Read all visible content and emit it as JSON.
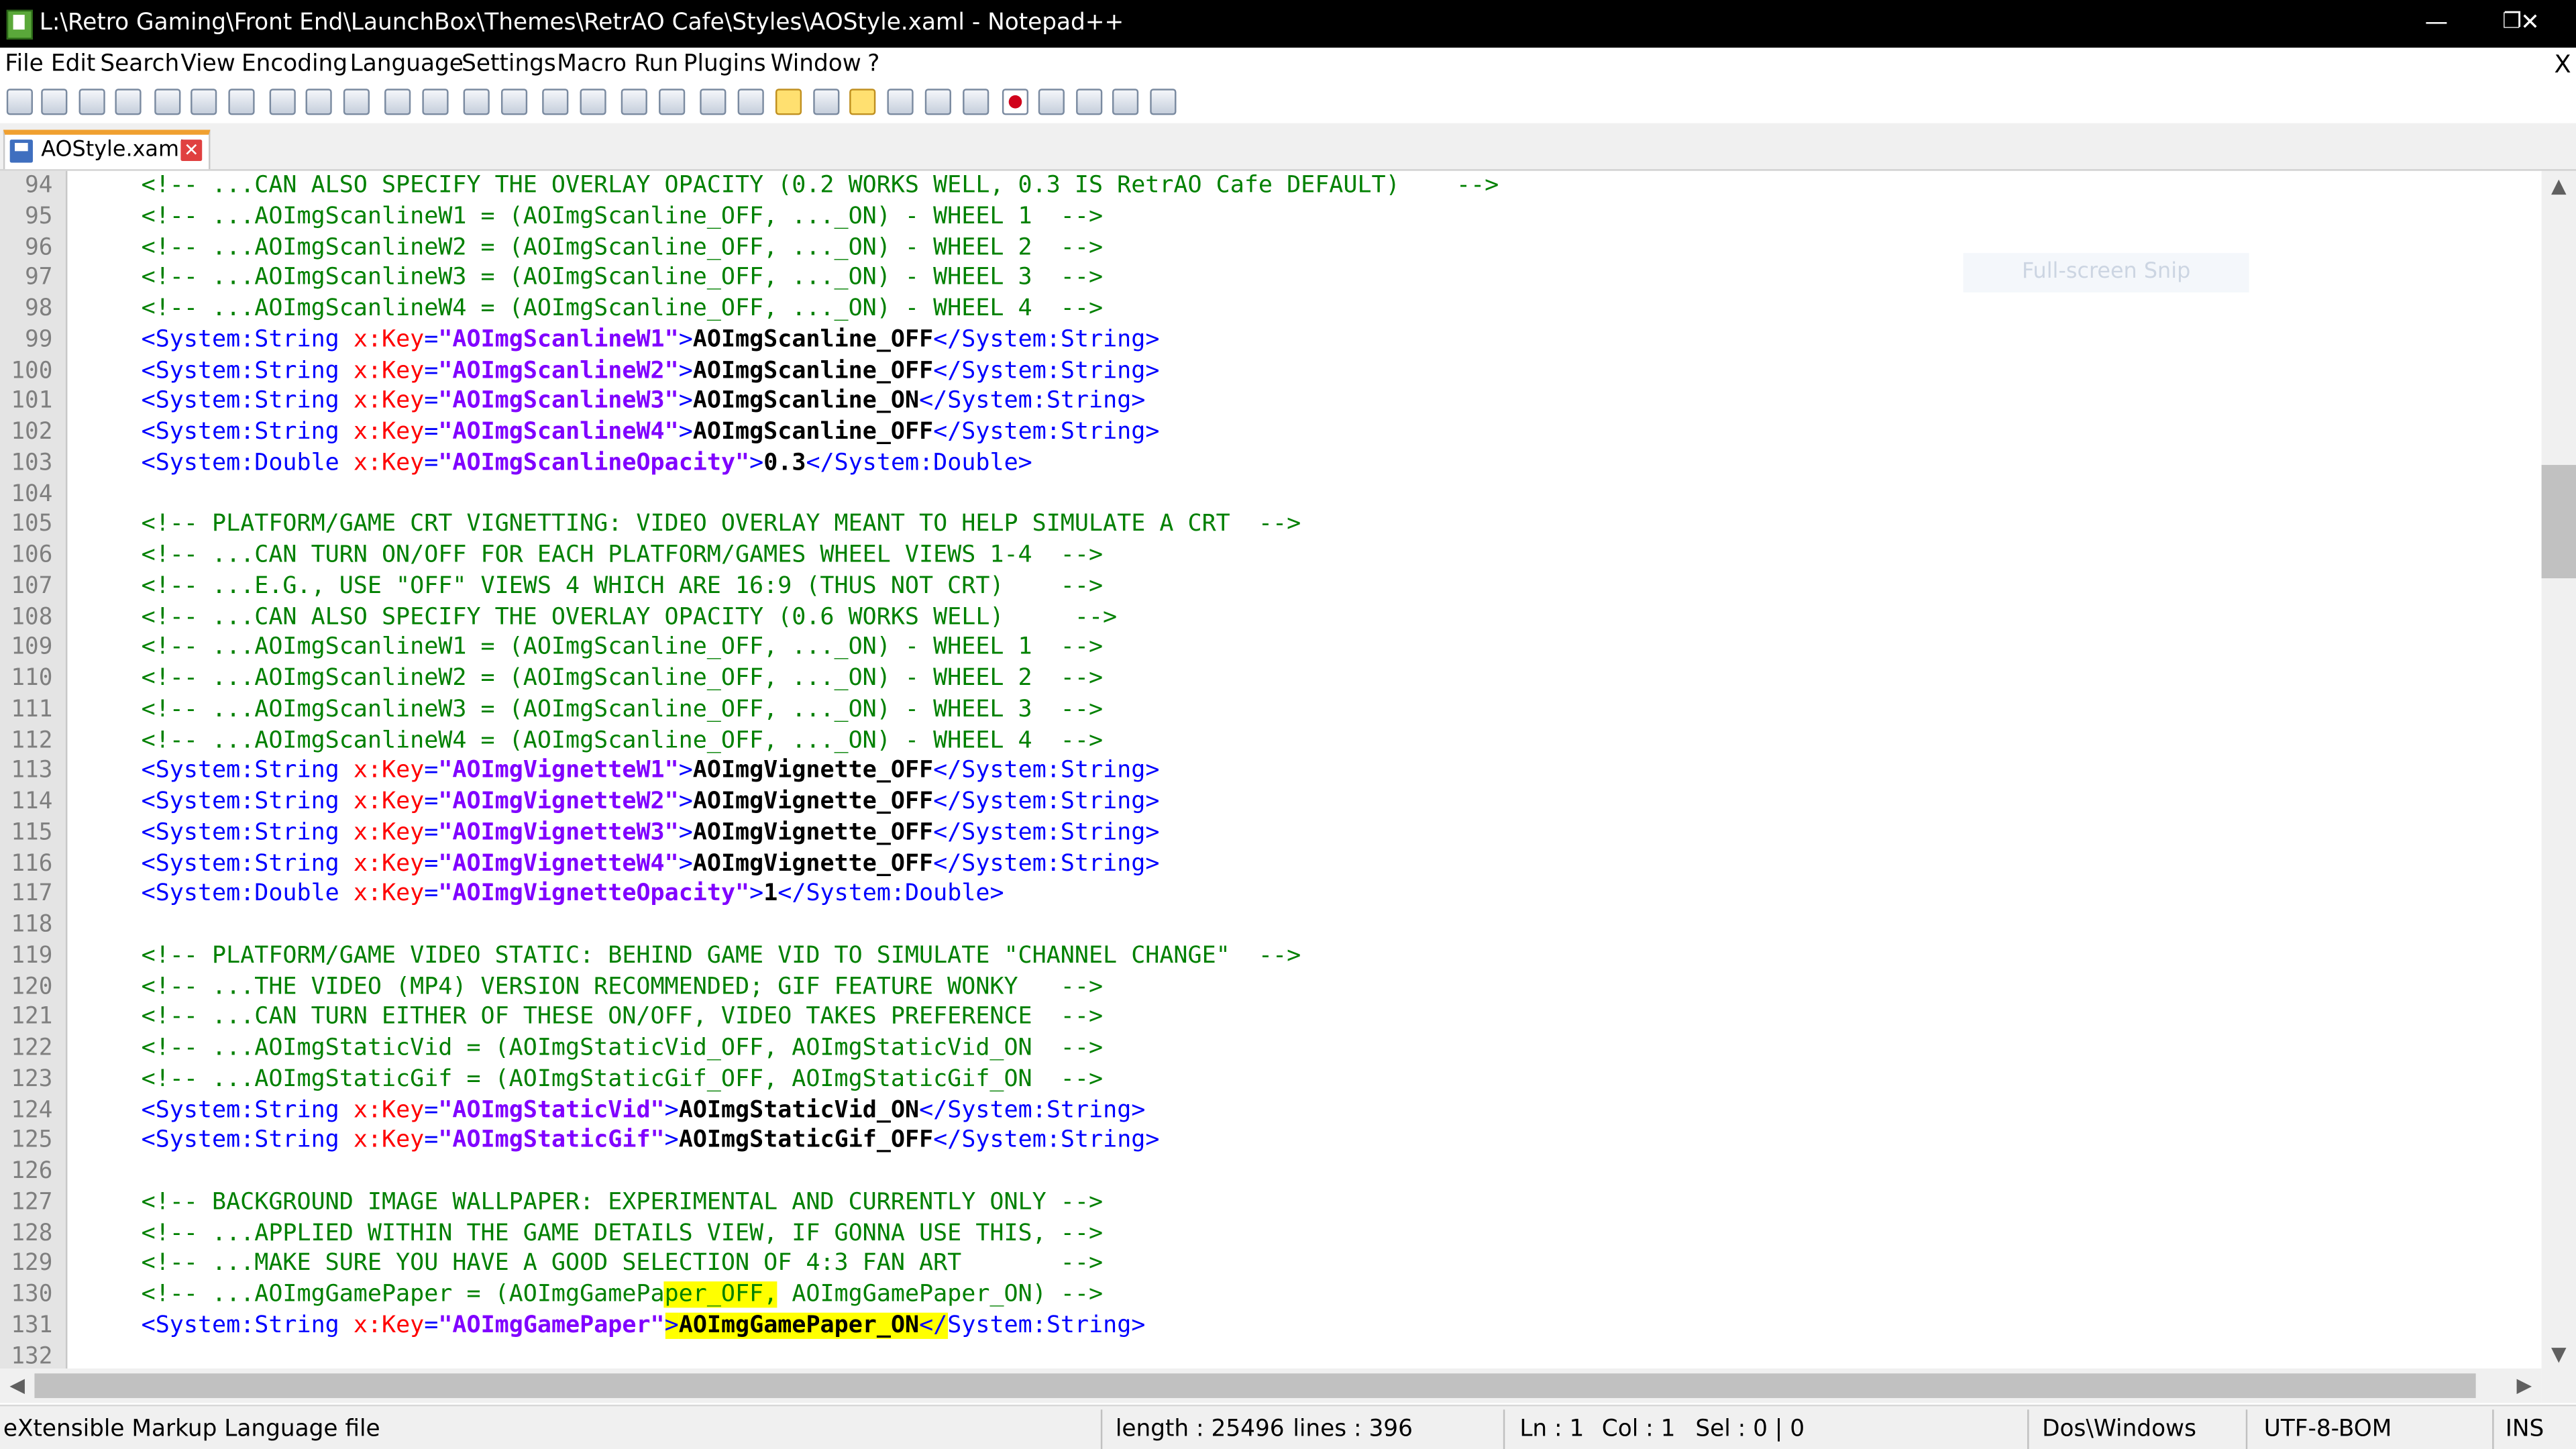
{
  "window": {
    "title": "L:\\Retro Gaming\\Front End\\LaunchBox\\Themes\\RetrAO Cafe\\Styles\\AOStyle.xaml - Notepad++",
    "minimize": "—",
    "maximize": "❐",
    "close": "✕"
  },
  "menu": {
    "items": [
      "File",
      "Edit",
      "Search",
      "View",
      "Encoding",
      "Language",
      "Settings",
      "Macro",
      "Run",
      "Plugins",
      "Window",
      "?"
    ],
    "close": "X"
  },
  "toolbar": {
    "icons": [
      "new-file-icon",
      "open-file-icon",
      "save-icon",
      "save-all-icon",
      "close-icon",
      "close-all-icon",
      "print-icon",
      "cut-icon",
      "copy-icon",
      "paste-icon",
      "undo-icon",
      "redo-icon",
      "find-icon",
      "replace-icon",
      "zoom-in-icon",
      "zoom-out-icon",
      "sync-scroll-vertical-icon",
      "sync-scroll-horizontal-icon",
      "word-wrap-icon",
      "show-all-characters-icon",
      "indent-guide-icon",
      "document-map-icon",
      "function-list-icon",
      "folder-as-workspace-icon",
      "monitoring-icon",
      "start-recording-icon",
      "stop-recording-icon",
      "playback-icon",
      "run-macro-multiple-icon",
      "save-macro-icon"
    ]
  },
  "tab": {
    "label": "AOStyle.xaml",
    "close": "✕"
  },
  "editor": {
    "lines": [
      {
        "n": "94",
        "segments": [
          {
            "t": "<!-- ...CAN ALSO SPECIFY THE OVERLAY OPACITY (0.2 WORKS WELL, 0.3 IS RetrAO Cafe DEFAULT)    -->",
            "c": "comment"
          }
        ]
      },
      {
        "n": "95",
        "segments": [
          {
            "t": "<!-- ...AOImgScanlineW1 = (AOImgScanline_OFF, ..._ON) - WHEEL 1  -->",
            "c": "comment"
          }
        ]
      },
      {
        "n": "96",
        "segments": [
          {
            "t": "<!-- ...AOImgScanlineW2 = (AOImgScanline_OFF, ..._ON) - WHEEL 2  -->",
            "c": "comment"
          }
        ]
      },
      {
        "n": "97",
        "segments": [
          {
            "t": "<!-- ...AOImgScanlineW3 = (AOImgScanline_OFF, ..._ON) - WHEEL 3  -->",
            "c": "comment"
          }
        ]
      },
      {
        "n": "98",
        "segments": [
          {
            "t": "<!-- ...AOImgScanlineW4 = (AOImgScanline_OFF, ..._ON) - WHEEL 4  -->",
            "c": "comment"
          }
        ]
      },
      {
        "n": "99",
        "segments": [
          {
            "t": "<System:String ",
            "c": "tag"
          },
          {
            "t": "x:Key",
            "c": "attr"
          },
          {
            "t": "=",
            "c": "tag"
          },
          {
            "t": "\"AOImgScanlineW1\"",
            "c": "val"
          },
          {
            "t": ">",
            "c": "tag"
          },
          {
            "t": "AOImgScanline_OFF",
            "c": "text"
          },
          {
            "t": "</System:String>",
            "c": "tag"
          }
        ]
      },
      {
        "n": "100",
        "segments": [
          {
            "t": "<System:String ",
            "c": "tag"
          },
          {
            "t": "x:Key",
            "c": "attr"
          },
          {
            "t": "=",
            "c": "tag"
          },
          {
            "t": "\"AOImgScanlineW2\"",
            "c": "val"
          },
          {
            "t": ">",
            "c": "tag"
          },
          {
            "t": "AOImgScanline_OFF",
            "c": "text"
          },
          {
            "t": "</System:String>",
            "c": "tag"
          }
        ]
      },
      {
        "n": "101",
        "segments": [
          {
            "t": "<System:String ",
            "c": "tag"
          },
          {
            "t": "x:Key",
            "c": "attr"
          },
          {
            "t": "=",
            "c": "tag"
          },
          {
            "t": "\"AOImgScanlineW3\"",
            "c": "val"
          },
          {
            "t": ">",
            "c": "tag"
          },
          {
            "t": "AOImgScanline_ON",
            "c": "text"
          },
          {
            "t": "</System:String>",
            "c": "tag"
          }
        ]
      },
      {
        "n": "102",
        "segments": [
          {
            "t": "<System:String ",
            "c": "tag"
          },
          {
            "t": "x:Key",
            "c": "attr"
          },
          {
            "t": "=",
            "c": "tag"
          },
          {
            "t": "\"AOImgScanlineW4\"",
            "c": "val"
          },
          {
            "t": ">",
            "c": "tag"
          },
          {
            "t": "AOImgScanline_OFF",
            "c": "text"
          },
          {
            "t": "</System:String>",
            "c": "tag"
          }
        ]
      },
      {
        "n": "103",
        "segments": [
          {
            "t": "<System:Double ",
            "c": "tag"
          },
          {
            "t": "x:Key",
            "c": "attr"
          },
          {
            "t": "=",
            "c": "tag"
          },
          {
            "t": "\"AOImgScanlineOpacity\"",
            "c": "val"
          },
          {
            "t": ">",
            "c": "tag"
          },
          {
            "t": "0.3",
            "c": "text"
          },
          {
            "t": "</System:Double>",
            "c": "tag"
          }
        ]
      },
      {
        "n": "104",
        "segments": []
      },
      {
        "n": "105",
        "segments": [
          {
            "t": "<!-- PLATFORM/GAME CRT VIGNETTING: VIDEO OVERLAY MEANT TO HELP SIMULATE A CRT  -->",
            "c": "comment"
          }
        ]
      },
      {
        "n": "106",
        "segments": [
          {
            "t": "<!-- ...CAN TURN ON/OFF FOR EACH PLATFORM/GAMES WHEEL VIEWS 1-4  -->",
            "c": "comment"
          }
        ]
      },
      {
        "n": "107",
        "segments": [
          {
            "t": "<!-- ...E.G., USE \"OFF\" VIEWS 4 WHICH ARE 16:9 (THUS NOT CRT)    -->",
            "c": "comment"
          }
        ]
      },
      {
        "n": "108",
        "segments": [
          {
            "t": "<!-- ...CAN ALSO SPECIFY THE OVERLAY OPACITY (0.6 WORKS WELL)     -->",
            "c": "comment"
          }
        ]
      },
      {
        "n": "109",
        "segments": [
          {
            "t": "<!-- ...AOImgScanlineW1 = (AOImgScanline_OFF, ..._ON) - WHEEL 1  -->",
            "c": "comment"
          }
        ]
      },
      {
        "n": "110",
        "segments": [
          {
            "t": "<!-- ...AOImgScanlineW2 = (AOImgScanline_OFF, ..._ON) - WHEEL 2  -->",
            "c": "comment"
          }
        ]
      },
      {
        "n": "111",
        "segments": [
          {
            "t": "<!-- ...AOImgScanlineW3 = (AOImgScanline_OFF, ..._ON) - WHEEL 3  -->",
            "c": "comment"
          }
        ]
      },
      {
        "n": "112",
        "segments": [
          {
            "t": "<!-- ...AOImgScanlineW4 = (AOImgScanline_OFF, ..._ON) - WHEEL 4  -->",
            "c": "comment"
          }
        ]
      },
      {
        "n": "113",
        "segments": [
          {
            "t": "<System:String ",
            "c": "tag"
          },
          {
            "t": "x:Key",
            "c": "attr"
          },
          {
            "t": "=",
            "c": "tag"
          },
          {
            "t": "\"AOImgVignetteW1\"",
            "c": "val"
          },
          {
            "t": ">",
            "c": "tag"
          },
          {
            "t": "AOImgVignette_OFF",
            "c": "text"
          },
          {
            "t": "</System:String>",
            "c": "tag"
          }
        ]
      },
      {
        "n": "114",
        "segments": [
          {
            "t": "<System:String ",
            "c": "tag"
          },
          {
            "t": "x:Key",
            "c": "attr"
          },
          {
            "t": "=",
            "c": "tag"
          },
          {
            "t": "\"AOImgVignetteW2\"",
            "c": "val"
          },
          {
            "t": ">",
            "c": "tag"
          },
          {
            "t": "AOImgVignette_OFF",
            "c": "text"
          },
          {
            "t": "</System:String>",
            "c": "tag"
          }
        ]
      },
      {
        "n": "115",
        "segments": [
          {
            "t": "<System:String ",
            "c": "tag"
          },
          {
            "t": "x:Key",
            "c": "attr"
          },
          {
            "t": "=",
            "c": "tag"
          },
          {
            "t": "\"AOImgVignetteW3\"",
            "c": "val"
          },
          {
            "t": ">",
            "c": "tag"
          },
          {
            "t": "AOImgVignette_OFF",
            "c": "text"
          },
          {
            "t": "</System:String>",
            "c": "tag"
          }
        ]
      },
      {
        "n": "116",
        "segments": [
          {
            "t": "<System:String ",
            "c": "tag"
          },
          {
            "t": "x:Key",
            "c": "attr"
          },
          {
            "t": "=",
            "c": "tag"
          },
          {
            "t": "\"AOImgVignetteW4\"",
            "c": "val"
          },
          {
            "t": ">",
            "c": "tag"
          },
          {
            "t": "AOImgVignette_OFF",
            "c": "text"
          },
          {
            "t": "</System:String>",
            "c": "tag"
          }
        ]
      },
      {
        "n": "117",
        "segments": [
          {
            "t": "<System:Double ",
            "c": "tag"
          },
          {
            "t": "x:Key",
            "c": "attr"
          },
          {
            "t": "=",
            "c": "tag"
          },
          {
            "t": "\"AOImgVignetteOpacity\"",
            "c": "val"
          },
          {
            "t": ">",
            "c": "tag"
          },
          {
            "t": "1",
            "c": "text"
          },
          {
            "t": "</System:Double>",
            "c": "tag"
          }
        ]
      },
      {
        "n": "118",
        "segments": []
      },
      {
        "n": "119",
        "segments": [
          {
            "t": "<!-- PLATFORM/GAME VIDEO STATIC: BEHIND GAME VID TO SIMULATE \"CHANNEL CHANGE\"  -->",
            "c": "comment"
          }
        ]
      },
      {
        "n": "120",
        "segments": [
          {
            "t": "<!-- ...THE VIDEO (MP4) VERSION RECOMMENDED; GIF FEATURE WONKY   -->",
            "c": "comment"
          }
        ]
      },
      {
        "n": "121",
        "segments": [
          {
            "t": "<!-- ...CAN TURN EITHER OF THESE ON/OFF, VIDEO TAKES PREFERENCE  -->",
            "c": "comment"
          }
        ]
      },
      {
        "n": "122",
        "segments": [
          {
            "t": "<!-- ...AOImgStaticVid = (AOImgStaticVid_OFF, AOImgStaticVid_ON  -->",
            "c": "comment"
          }
        ]
      },
      {
        "n": "123",
        "segments": [
          {
            "t": "<!-- ...AOImgStaticGif = (AOImgStaticGif_OFF, AOImgStaticGif_ON  -->",
            "c": "comment"
          }
        ]
      },
      {
        "n": "124",
        "segments": [
          {
            "t": "<System:String ",
            "c": "tag"
          },
          {
            "t": "x:Key",
            "c": "attr"
          },
          {
            "t": "=",
            "c": "tag"
          },
          {
            "t": "\"AOImgStaticVid\"",
            "c": "val"
          },
          {
            "t": ">",
            "c": "tag"
          },
          {
            "t": "AOImgStaticVid_ON",
            "c": "text"
          },
          {
            "t": "</System:String>",
            "c": "tag"
          }
        ]
      },
      {
        "n": "125",
        "segments": [
          {
            "t": "<System:String ",
            "c": "tag"
          },
          {
            "t": "x:Key",
            "c": "attr"
          },
          {
            "t": "=",
            "c": "tag"
          },
          {
            "t": "\"AOImgStaticGif\"",
            "c": "val"
          },
          {
            "t": ">",
            "c": "tag"
          },
          {
            "t": "AOImgStaticGif_OFF",
            "c": "text"
          },
          {
            "t": "</System:String>",
            "c": "tag"
          }
        ]
      },
      {
        "n": "126",
        "segments": []
      },
      {
        "n": "127",
        "segments": [
          {
            "t": "<!-- BACKGROUND IMAGE WALLPAPER: EXPERIMENTAL AND CURRENTLY ONLY -->",
            "c": "comment"
          }
        ]
      },
      {
        "n": "128",
        "segments": [
          {
            "t": "<!-- ...APPLIED WITHIN THE GAME DETAILS VIEW, IF GONNA USE THIS, -->",
            "c": "comment"
          }
        ]
      },
      {
        "n": "129",
        "segments": [
          {
            "t": "<!-- ...MAKE SURE YOU HAVE A GOOD SELECTION OF 4:3 FAN ART       -->",
            "c": "comment"
          }
        ]
      },
      {
        "n": "130",
        "segments": [
          {
            "t": "<!-- ...AOImgGamePaper = (AOImgGamePa",
            "c": "comment"
          },
          {
            "t": "per_OFF,",
            "c": "comment hl"
          },
          {
            "t": " AOImgGamePaper_ON) -->",
            "c": "comment"
          }
        ]
      },
      {
        "n": "131",
        "segments": [
          {
            "t": "<System:String ",
            "c": "tag"
          },
          {
            "t": "x:Key",
            "c": "attr"
          },
          {
            "t": "=",
            "c": "tag"
          },
          {
            "t": "\"AOImgGamePaper\"",
            "c": "val"
          },
          {
            "t": ">",
            "c": "tag hl"
          },
          {
            "t": "AOImgGamePaper_ON",
            "c": "text hl"
          },
          {
            "t": "</",
            "c": "tag hl"
          },
          {
            "t": "System:String>",
            "c": "tag"
          }
        ]
      },
      {
        "n": "132",
        "segments": []
      }
    ]
  },
  "overlay": {
    "snip_label": "Full-screen Snip"
  },
  "scrollbars": {
    "up": "▲",
    "down": "▼",
    "left": "◀",
    "right": "▶"
  },
  "status": {
    "file_type": "eXtensible Markup Language file",
    "length": "length : 25496",
    "lines": "lines : 396",
    "ln": "Ln : 1",
    "col": "Col : 1",
    "sel": "Sel : 0 | 0",
    "eol": "Dos\\Windows",
    "encoding": "UTF-8-BOM",
    "mode": "INS"
  }
}
